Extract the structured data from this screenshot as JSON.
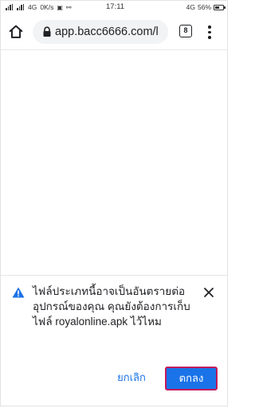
{
  "status_bar": {
    "left_text": "4G",
    "network_speed": "0K/s",
    "time": "17:11",
    "network_type": "4G",
    "battery_percent": "56%",
    "battery_level": 0.56
  },
  "toolbar": {
    "url": "app.bacc6666.com/l",
    "tab_count": "8"
  },
  "dialog": {
    "message": "ไฟล์ประเภทนี้อาจเป็นอันตรายต่ออุปกรณ์ของคุณ คุณยังต้องการเก็บไฟล์ royalonline.apk ไว้ไหม",
    "cancel_label": "ยกเลิก",
    "ok_label": "ตกลง"
  },
  "icons": {
    "home": "home-icon",
    "lock": "lock-icon",
    "menu": "more-vert-icon",
    "warning": "warning-icon",
    "close": "close-icon"
  },
  "colors": {
    "accent": "#1a73e8",
    "highlight_border": "#c2185b"
  }
}
